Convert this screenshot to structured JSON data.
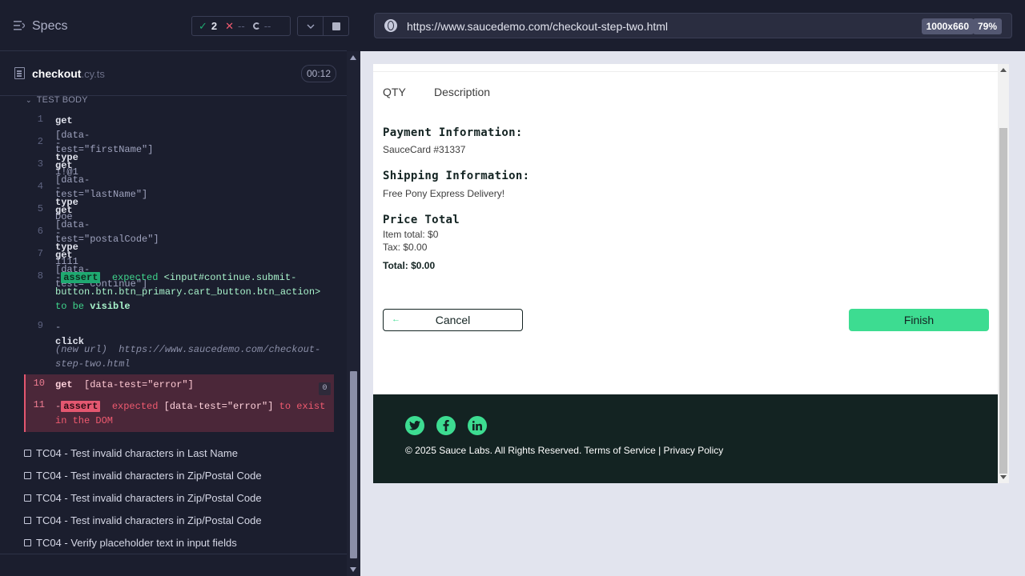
{
  "reporter": {
    "specs_label": "Specs",
    "stats": {
      "passed": "2",
      "failed": "--",
      "pending": "--"
    },
    "file": {
      "name": "checkout",
      "ext": ".cy.ts",
      "duration": "00:12"
    },
    "test_body_label": "TEST BODY",
    "commands": [
      {
        "num": "1",
        "name": "get",
        "arg": "[data-test=\"firstName\"]"
      },
      {
        "num": "2",
        "name": "type",
        "arg": "1!@1"
      },
      {
        "num": "3",
        "name": "get",
        "arg": "[data-test=\"lastName\"]"
      },
      {
        "num": "4",
        "name": "type",
        "arg": "Doe"
      },
      {
        "num": "5",
        "name": "get",
        "arg": "[data-test=\"postalCode\"]"
      },
      {
        "num": "6",
        "name": "type",
        "arg": "1111"
      },
      {
        "num": "7",
        "name": "get",
        "arg": "[data-test=\"continue\"]"
      },
      {
        "num": "8",
        "badge": "assert",
        "t1": "expected",
        "t2": "<input#continue.submit-button.btn.btn_primary.cart_button.btn_action>",
        "t3": "to be",
        "t4": "visible"
      },
      {
        "num": "9",
        "name": "click"
      }
    ],
    "new_url": {
      "label": "(new url)",
      "url": "https://www.saucedemo.com/checkout-step-two.html"
    },
    "errors": [
      {
        "num": "10",
        "name": "get",
        "arg": "[data-test=\"error\"]",
        "count": "0"
      },
      {
        "num": "11",
        "badge": "assert",
        "t1": "expected",
        "t2": "[data-test=\"error\"]",
        "t3": "to exist in the DOM"
      }
    ],
    "tests": [
      "TC04 - Test invalid characters in Last Name",
      "TC04 - Test invalid characters in Zip/Postal Code",
      "TC04 - Test invalid characters in Zip/Postal Code",
      "TC04 - Test invalid characters in Zip/Postal Code",
      "TC04 - Verify placeholder text in input fields"
    ]
  },
  "aut": {
    "url": "https://www.saucedemo.com/checkout-step-two.html",
    "viewport": "1000x660",
    "zoom": "79%",
    "page": {
      "qty_header": "QTY",
      "desc_header": "Description",
      "payment_label": "Payment Information:",
      "payment_value": "SauceCard #31337",
      "shipping_label": "Shipping Information:",
      "shipping_value": "Free Pony Express Delivery!",
      "price_label": "Price Total",
      "item_total": "Item total: $0",
      "tax": "Tax: $0.00",
      "total": "Total: $0.00",
      "cancel_label": "Cancel",
      "finish_label": "Finish",
      "social": [
        "twitter",
        "facebook",
        "linkedin"
      ],
      "copyright": "© 2025 Sauce Labs. All Rights Reserved. Terms of Service | Privacy Policy"
    }
  },
  "colors": {
    "reporter_bg": "#1b1e2e",
    "pass_green": "#1fa971",
    "fail_red": "#e45770",
    "sauce_green": "#3ddc91",
    "sauce_dark": "#132322"
  }
}
